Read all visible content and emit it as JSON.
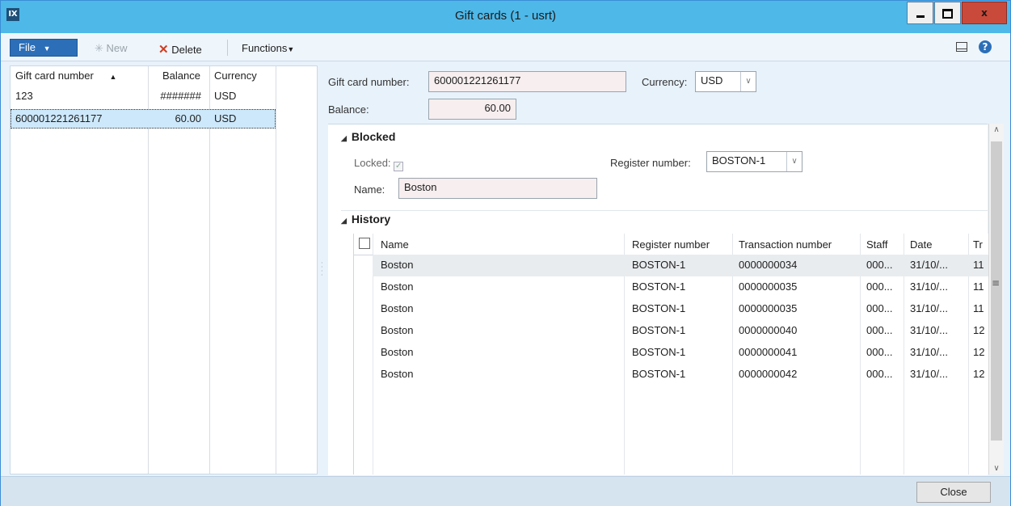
{
  "window": {
    "title": "Gift cards (1 - usrt)"
  },
  "toolbar": {
    "file_label": "File",
    "new_label": "New",
    "delete_label": "Delete",
    "functions_label": "Functions"
  },
  "left_grid": {
    "columns": [
      "Gift card number",
      "Balance",
      "Currency"
    ],
    "rows": [
      {
        "number": "123",
        "balance": "#######",
        "currency": "USD"
      },
      {
        "number": "600001221261177",
        "balance": "60.00",
        "currency": "USD"
      }
    ]
  },
  "details": {
    "gift_card_number_label": "Gift card number:",
    "gift_card_number_value": "600001221261177",
    "currency_label": "Currency:",
    "currency_value": "USD",
    "balance_label": "Balance:",
    "balance_value": "60.00"
  },
  "blocked": {
    "title": "Blocked",
    "locked_label": "Locked:",
    "register_label": "Register number:",
    "register_value": "BOSTON-1",
    "name_label": "Name:",
    "name_value": "Boston"
  },
  "history": {
    "title": "History",
    "columns": [
      "Name",
      "Register number",
      "Transaction number",
      "Staff",
      "Date",
      "Tr"
    ],
    "rows": [
      {
        "name": "Boston",
        "register": "BOSTON-1",
        "transaction": "0000000034",
        "staff": "000...",
        "date": "31/10/...",
        "tr": "11"
      },
      {
        "name": "Boston",
        "register": "BOSTON-1",
        "transaction": "0000000035",
        "staff": "000...",
        "date": "31/10/...",
        "tr": "11"
      },
      {
        "name": "Boston",
        "register": "BOSTON-1",
        "transaction": "0000000035",
        "staff": "000...",
        "date": "31/10/...",
        "tr": "11"
      },
      {
        "name": "Boston",
        "register": "BOSTON-1",
        "transaction": "0000000040",
        "staff": "000...",
        "date": "31/10/...",
        "tr": "12"
      },
      {
        "name": "Boston",
        "register": "BOSTON-1",
        "transaction": "0000000041",
        "staff": "000...",
        "date": "31/10/...",
        "tr": "12"
      },
      {
        "name": "Boston",
        "register": "BOSTON-1",
        "transaction": "0000000042",
        "staff": "000...",
        "date": "31/10/...",
        "tr": "12"
      }
    ]
  },
  "footer": {
    "close_label": "Close"
  }
}
